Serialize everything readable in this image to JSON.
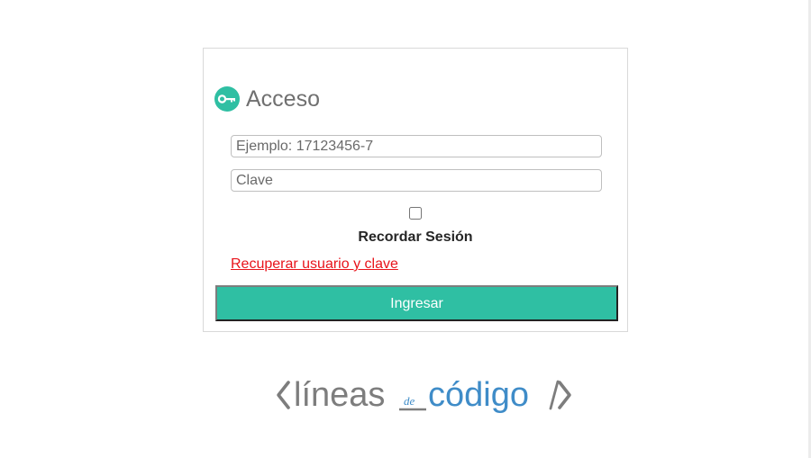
{
  "login": {
    "title": "Acceso",
    "username_placeholder": "Ejemplo: 17123456-7",
    "password_placeholder": "Clave",
    "remember_label": "Recordar Sesión",
    "recover_link": "Recuperar usuario y clave",
    "submit_label": "Ingresar",
    "remember_checked": false
  },
  "brand": {
    "name_part1": "líneas",
    "name_small": "de",
    "name_part2": "código"
  },
  "icons": {
    "title_icon": "key-icon"
  },
  "colors": {
    "accent": "#2fbfa3",
    "link": "#e8141b",
    "logo_gray": "#7d7d7d",
    "logo_blue": "#3f8cc8"
  }
}
